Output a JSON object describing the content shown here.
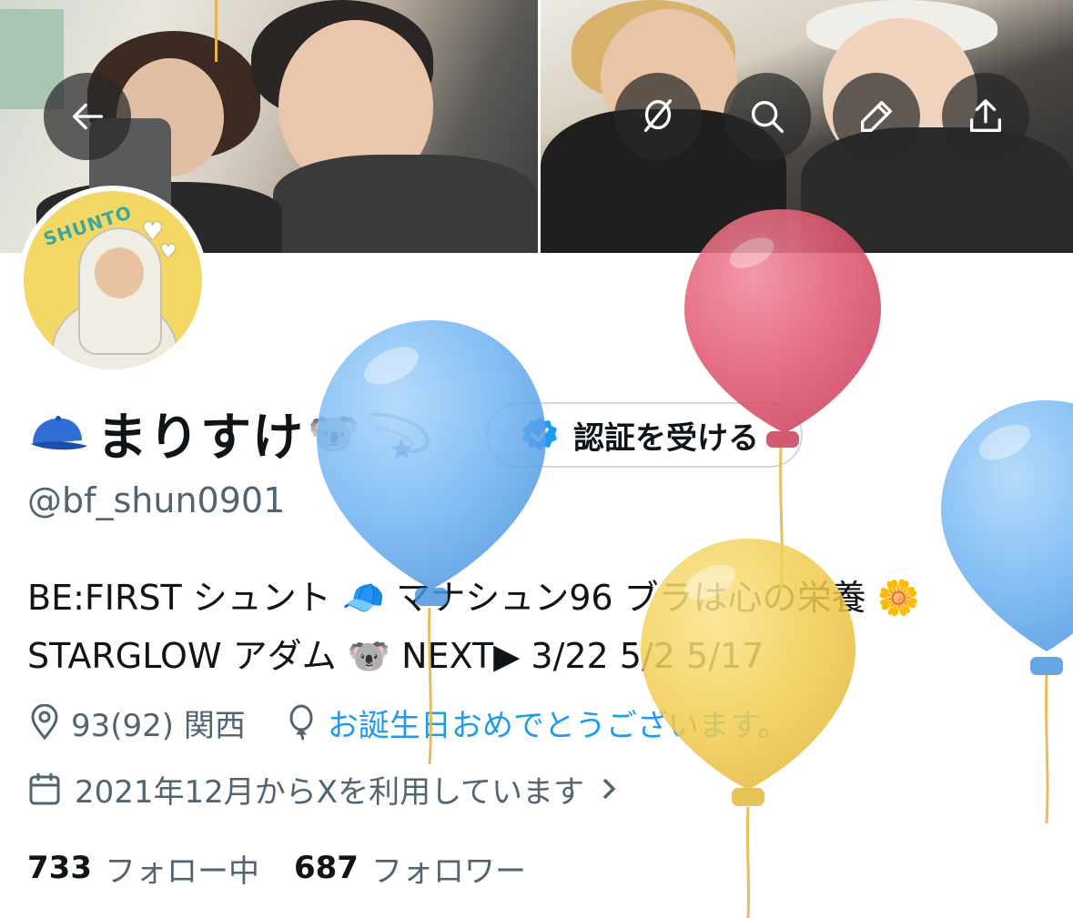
{
  "header": {
    "back_label": "back",
    "actions": [
      "hide-balloons",
      "search",
      "edit",
      "share"
    ]
  },
  "avatar": {
    "text": "SHUNTO"
  },
  "profile": {
    "name": "まりすけ",
    "verify_button": "認証を受ける",
    "handle": "@bf_shun0901",
    "bio_line1": "BE:FIRST シュント 🧢 マナシュン96 ブラは心の栄養 🌼",
    "bio_line2": "STARGLOW アダム 🐨 NEXT▶ 3/22 5/2 5/17",
    "location": "93(92) 関西",
    "birthday": "お誕生日おめでとうございます。",
    "joined": "2021年12月からXを利用しています",
    "following_count": "733",
    "following_label": "フォロー中",
    "followers_count": "687",
    "followers_label": "フォロワー"
  },
  "colors": {
    "accent": "#1d9bf0",
    "secondary_text": "#536471",
    "balloon_blue": "#6fb3f2",
    "balloon_red": "#e25a71",
    "balloon_yellow": "#f2cd4f"
  }
}
